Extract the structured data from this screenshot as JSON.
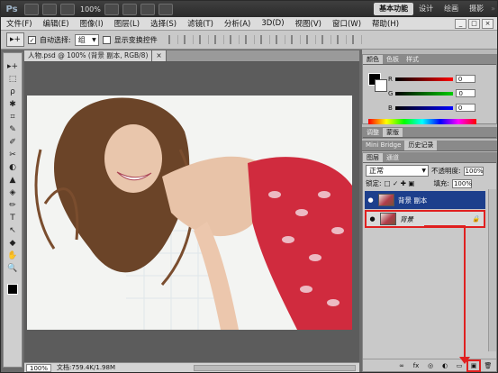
{
  "titlebar": {
    "logo": "Ps",
    "zoom": "100%",
    "workspaces": [
      "基本功能",
      "设计",
      "绘画",
      "摄影"
    ],
    "active_workspace": "基本功能",
    "more": "»"
  },
  "menu": [
    "文件(F)",
    "编辑(E)",
    "图像(I)",
    "图层(L)",
    "选择(S)",
    "滤镜(T)",
    "分析(A)",
    "3D(D)",
    "视图(V)",
    "窗口(W)",
    "帮助(H)"
  ],
  "window_controls": [
    "_",
    "□",
    "×"
  ],
  "options": {
    "tool_preset": "▸+",
    "auto_select_checkbox": "✓",
    "auto_select_label": "自动选择:",
    "auto_select_value": "组",
    "show_transform_label": "显示变换控件"
  },
  "tools": [
    "▸+",
    "⬚",
    "ρ",
    "✱",
    "⌗",
    "✎",
    "✐",
    "✂",
    "◐",
    "▲",
    "◈",
    "✏",
    "T",
    "↖",
    "◆",
    "✋",
    "🔍"
  ],
  "document": {
    "tab_title": "人物.psd @ 100% (背景 副本, RGB/8)",
    "tab_close": "×",
    "status_zoom": "100%",
    "status_doc": "文档:759.4K/1.98M"
  },
  "color_panel": {
    "tabs": [
      "颜色",
      "色板",
      "样式"
    ],
    "channels": [
      {
        "label": "R",
        "value": "0",
        "color": "#d22"
      },
      {
        "label": "G",
        "value": "0",
        "color": "#2b2"
      },
      {
        "label": "B",
        "value": "0",
        "color": "#22d"
      }
    ]
  },
  "adjust_panel": {
    "tabs": [
      "调整",
      "蒙版"
    ]
  },
  "history_panel": {
    "tabs": [
      "Mini Bridge",
      "历史记录"
    ]
  },
  "layers_panel": {
    "tabs": [
      "图层",
      "通道"
    ],
    "blend_mode": "正常",
    "opacity_label": "不透明度:",
    "opacity_value": "100%",
    "lock_label": "锁定:",
    "lock_icons": "□ ✓ ✚ ▣",
    "fill_label": "填充:",
    "fill_value": "100%",
    "layers": [
      {
        "name": "背景 副本",
        "selected": true
      },
      {
        "name": "背景",
        "locked": true
      }
    ],
    "footer_icons": [
      "∞",
      "fx",
      "◎",
      "◐",
      "▭",
      "▣",
      "🗑"
    ]
  }
}
